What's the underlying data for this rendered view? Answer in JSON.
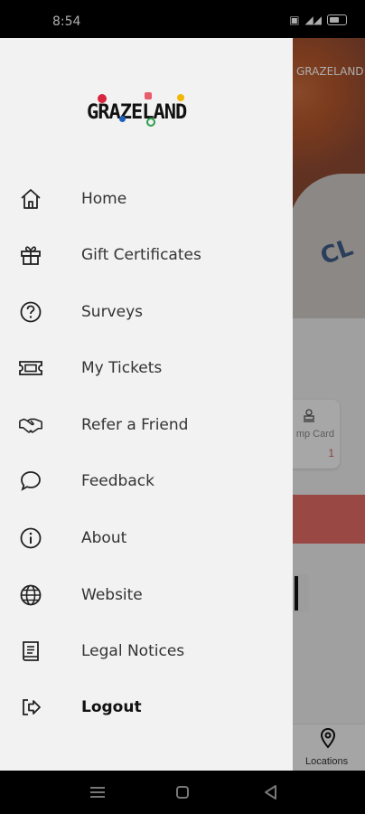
{
  "status": {
    "time": "8:54"
  },
  "drawer": {
    "brand": "GRAZELAND",
    "items": [
      {
        "label": "Home",
        "icon": "home-icon"
      },
      {
        "label": "Gift Certificates",
        "icon": "gift-icon"
      },
      {
        "label": "Surveys",
        "icon": "question-circle-icon"
      },
      {
        "label": "My Tickets",
        "icon": "ticket-icon"
      },
      {
        "label": "Refer a Friend",
        "icon": "handshake-icon"
      },
      {
        "label": "Feedback",
        "icon": "chat-bubble-icon"
      },
      {
        "label": "About",
        "icon": "info-circle-icon"
      },
      {
        "label": "Website",
        "icon": "globe-icon"
      },
      {
        "label": "Legal Notices",
        "icon": "book-icon"
      },
      {
        "label": "Logout",
        "icon": "logout-icon"
      }
    ]
  },
  "background": {
    "hero_text": "CL",
    "logo_small": "GRAZELAND",
    "card_label": "mp Card",
    "card_value": "1",
    "tab_label": "Locations"
  },
  "colors": {
    "drawer_bg": "#f2f2f2",
    "accent_red": "#e26a64"
  }
}
